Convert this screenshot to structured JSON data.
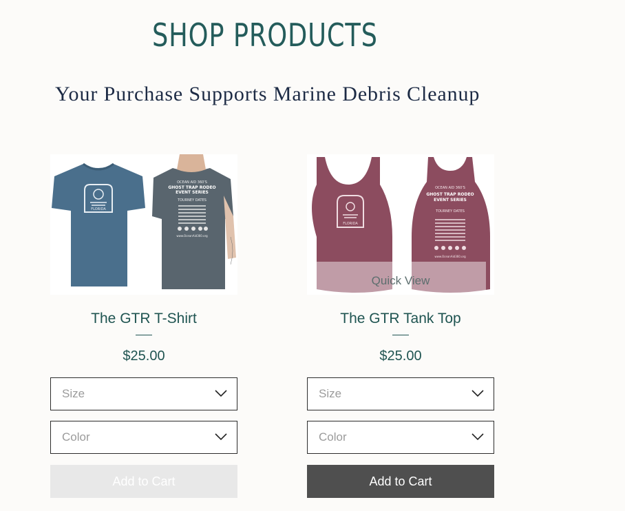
{
  "header": {
    "title": "SHOP PRODUCTS",
    "subtitle": "Your Purchase Supports Marine Debris Cleanup"
  },
  "products": [
    {
      "name": "The GTR T-Shirt",
      "price": "$25.00",
      "size_placeholder": "Size",
      "color_placeholder": "Color",
      "add_to_cart_label": "Add to Cart",
      "add_to_cart_enabled": false,
      "garment_color": "#4a6f8c",
      "print_front": {
        "line1": "GHOST TRAP RODEO",
        "line2": "FLORIDA"
      },
      "print_back": {
        "line1": "OCEAN AID 360'S",
        "line2": "GHOST TRAP RODEO",
        "line3": "EVENT SERIES",
        "line4": "TOURNEY DATES",
        "url": "www.OceanAid360.org"
      }
    },
    {
      "name": "The GTR Tank Top",
      "price": "$25.00",
      "size_placeholder": "Size",
      "color_placeholder": "Color",
      "add_to_cart_label": "Add to Cart",
      "add_to_cart_enabled": true,
      "quick_view_label": "Quick View",
      "garment_color": "#8c4c5f",
      "print_front": {
        "line1": "GHOST TRAP RODEO",
        "line2": "FLORIDA"
      },
      "print_back": {
        "line1": "OCEAN AID 360'S",
        "line2": "GHOST TRAP RODEO",
        "line3": "EVENT SERIES",
        "line4": "TOURNEY DATES",
        "url": "www.OceanAid360.org"
      }
    }
  ]
}
